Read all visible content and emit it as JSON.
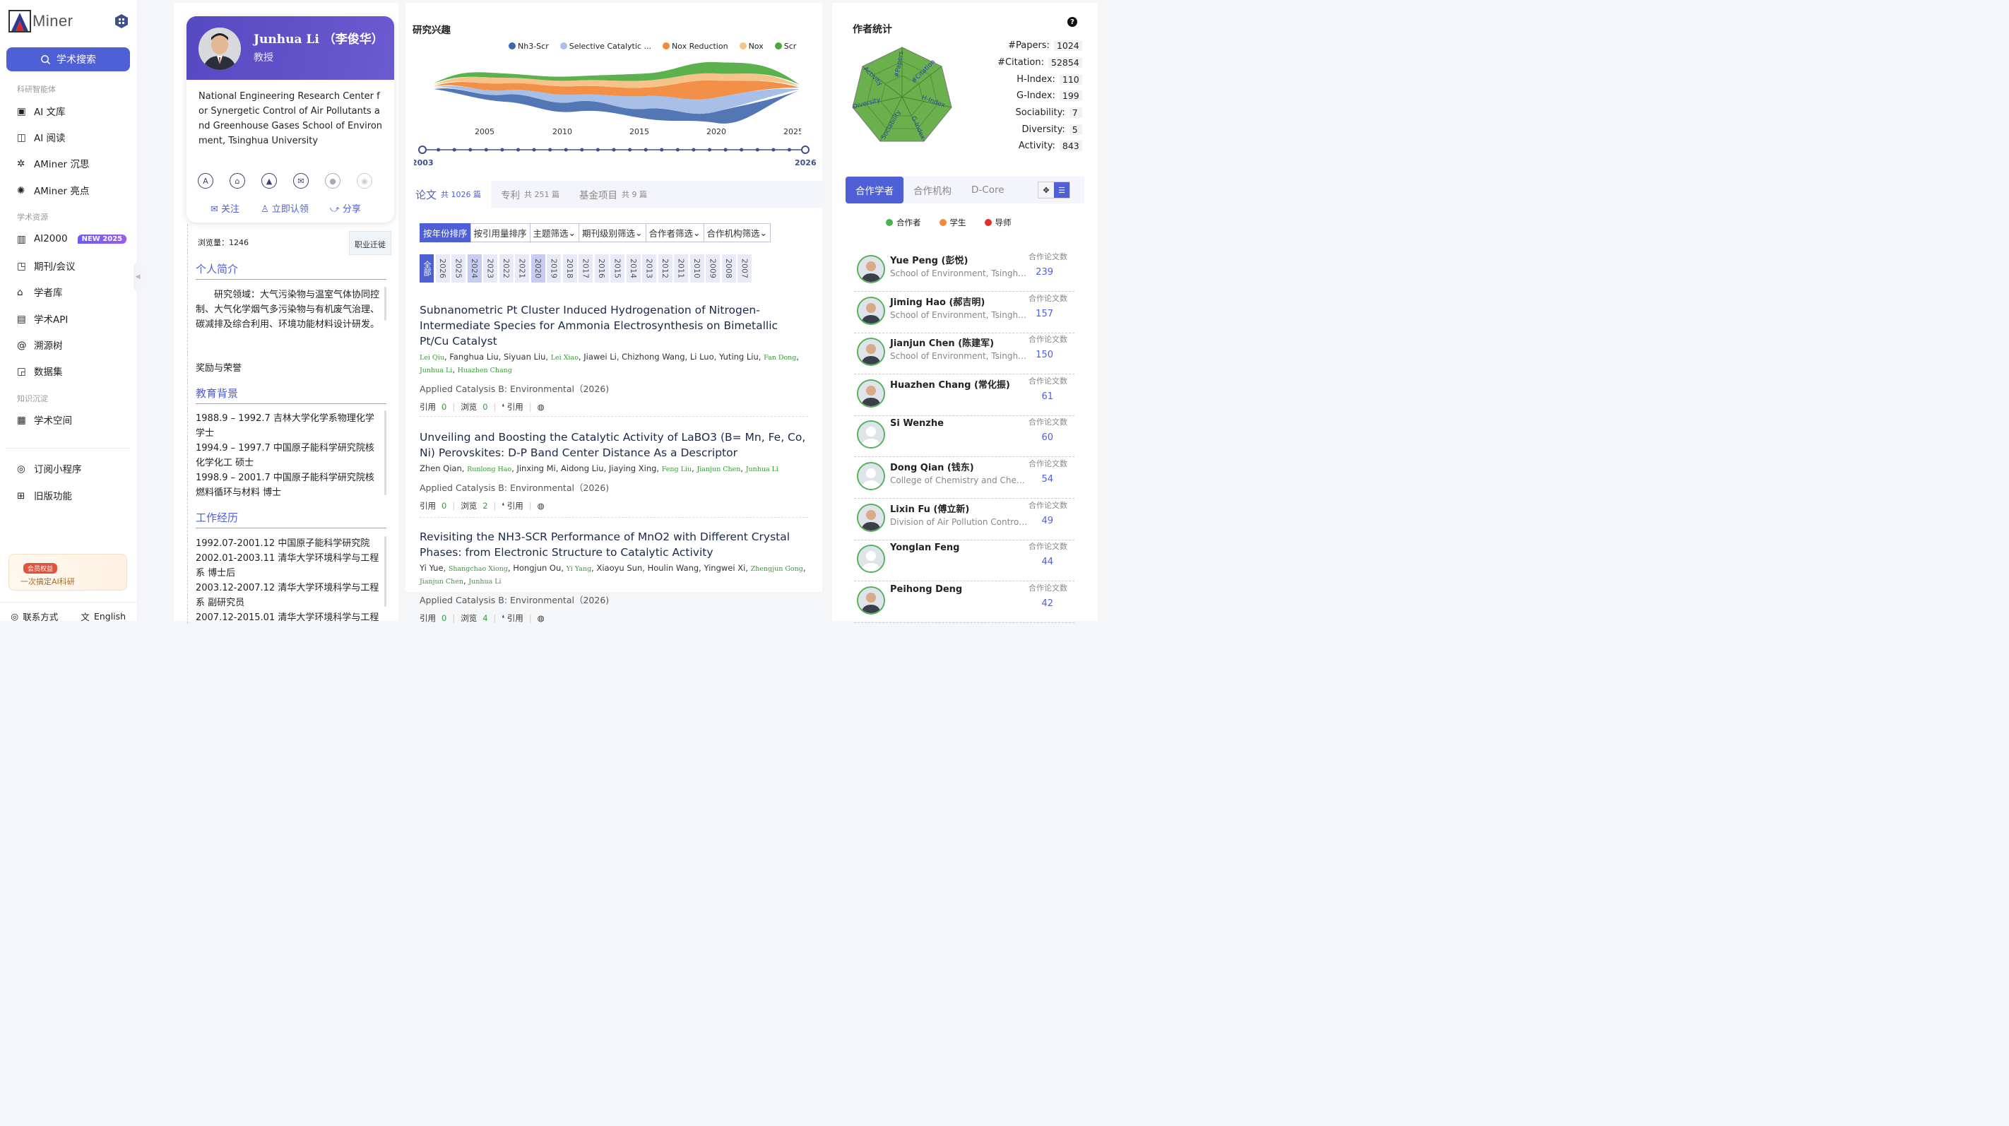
{
  "app": {
    "logo_text": "Miner"
  },
  "sidebar": {
    "search_label": "学术搜索",
    "sections": {
      "ai": "科研智能体",
      "resources": "学术资源",
      "knowledge": "知识沉淀"
    },
    "items": [
      {
        "label": "AI 文库",
        "icon": "book-icon"
      },
      {
        "label": "AI 阅读",
        "icon": "reader-icon"
      },
      {
        "label": "AMiner 沉思",
        "icon": "think-icon"
      },
      {
        "label": "AMiner 亮点",
        "icon": "spark-icon"
      },
      {
        "label": "AI2000",
        "icon": "chart-icon",
        "badge": "NEW 2025"
      },
      {
        "label": "期刊/会议",
        "icon": "journal-icon"
      },
      {
        "label": "学者库",
        "icon": "scholar-icon"
      },
      {
        "label": "学术API",
        "icon": "api-icon"
      },
      {
        "label": "溯源树",
        "icon": "tree-icon"
      },
      {
        "label": "数据集",
        "icon": "dataset-icon"
      },
      {
        "label": "学术空间",
        "icon": "space-icon"
      },
      {
        "label": "订阅小程序",
        "icon": "subscribe-icon"
      },
      {
        "label": "旧版功能",
        "icon": "legacy-icon"
      }
    ],
    "promo": {
      "tag": "会员权益",
      "text": "一次搞定AI科研"
    },
    "bottom": {
      "contact": "联系方式",
      "language": "English"
    }
  },
  "profile": {
    "name": "Junhua Li （李俊华）",
    "title": "教授",
    "affiliation": "National Engineering Research Center for Synergetic Control of Air Pollutants and Greenhouse Gases School of Environment, Tsinghua University",
    "actions": {
      "follow": "关注",
      "claim": "立即认领",
      "share": "分享"
    },
    "views": "浏览量：1246",
    "career": "职业迁徙",
    "sections": {
      "intro": {
        "heading": "个人简介",
        "text": "研究领域：大气污染物与温室气体协同控制、大气化学烟气多污染物与有机废气治理、碳减排及综合利用、环境功能材料设计研发。",
        "awards": "奖励与荣誉"
      },
      "education": {
        "heading": "教育背景",
        "lines": [
          "1988.9 – 1992.7 吉林大学化学系物理化学学士",
          "1994.9 – 1997.7 中国原子能科学研究院核化学化工 硕士",
          "1998.9 – 2001.7 中国原子能科学研究院核燃料循环与材料 博士"
        ]
      },
      "work": {
        "heading": "工作经历",
        "lines": [
          "1992.07-2001.12 中国原子能科学研究院",
          "2002.01-2003.11 清华大学环境科学与工程系 博士后",
          "2003.12-2007.12 清华大学环境科学与工程系 副研究员",
          "2007.12-2015.01 清华大学环境科学与工程"
        ]
      }
    }
  },
  "interests": {
    "title": "研究兴趣",
    "legend": [
      {
        "name": "Nh3-Scr",
        "color": "#3f68ac"
      },
      {
        "name": "Selective Catalytic ...",
        "color": "#a8c0e8"
      },
      {
        "name": "Nox Reduction",
        "color": "#f08a3c"
      },
      {
        "name": "Nox",
        "color": "#f6c48a"
      },
      {
        "name": "Scr",
        "color": "#4aa83c"
      }
    ],
    "axis_years": [
      "2005",
      "2010",
      "2015",
      "2020",
      "2025"
    ],
    "timeline_start": "2003",
    "timeline_end": "2026"
  },
  "tabs": [
    {
      "label": "论文",
      "count": "共 1026 篇"
    },
    {
      "label": "专利",
      "count": "共 251 篇"
    },
    {
      "label": "基金项目",
      "count": "共 9 篇"
    }
  ],
  "filters": [
    "按年份排序",
    "按引用量排序",
    "主题筛选",
    "期刊级别筛选",
    "合作者筛选",
    "合作机构筛选"
  ],
  "years": [
    "全部",
    "2026",
    "2025",
    "2024",
    "2023",
    "2022",
    "2021",
    "2020",
    "2019",
    "2018",
    "2017",
    "2016",
    "2015",
    "2014",
    "2013",
    "2012",
    "2011",
    "2010",
    "2009",
    "2008",
    "2007"
  ],
  "papers": [
    {
      "title": "Subnanometric Pt Cluster Induced Hydrogenation of Nitrogen-Intermediate Species for Ammonia Electrosynthesis on Bimetallic Pt/Cu Catalyst",
      "authors": [
        [
          "Lei Qiu",
          true
        ],
        [
          "Fanghua Liu",
          false
        ],
        [
          "Siyuan Liu",
          false
        ],
        [
          "Lei Xiao",
          true
        ],
        [
          "Jiawei Li",
          false
        ],
        [
          "Chizhong Wang",
          false
        ],
        [
          "Li Luo",
          false
        ],
        [
          "Yuting Liu",
          false
        ],
        [
          "Fan Dong",
          true
        ],
        [
          "Junhua Li",
          true
        ],
        [
          "Huazhen Chang",
          true
        ]
      ],
      "venue": "Applied Catalysis B: Environmental（2026)",
      "cite_label": "引用",
      "cite": "0",
      "view_label": "浏览",
      "view": "0",
      "quote": "引用"
    },
    {
      "title": "Unveiling and Boosting the Catalytic Activity of LaBO3 (B= Mn, Fe, Co, Ni) Perovskites: D-P Band Center Distance As a Descriptor",
      "authors": [
        [
          "Zhen Qian",
          false
        ],
        [
          "Runlong Hao",
          true
        ],
        [
          "Jinxing Mi",
          false
        ],
        [
          "Aidong Liu",
          false
        ],
        [
          "Jiaying Xing",
          false
        ],
        [
          "Feng Liu",
          true
        ],
        [
          "Jianjun Chen",
          true
        ],
        [
          "Junhua Li",
          true
        ]
      ],
      "venue": "Applied Catalysis B: Environmental（2026)",
      "cite_label": "引用",
      "cite": "0",
      "view_label": "浏览",
      "view": "2",
      "quote": "引用"
    },
    {
      "title": "Revisiting the NH3-SCR Performance of MnO2 with Different Crystal Phases: from Electronic Structure to Catalytic Activity",
      "authors": [
        [
          "Yi Yue",
          false
        ],
        [
          "Shangchao Xiong",
          true
        ],
        [
          "Hongjun Ou",
          false
        ],
        [
          "Yi Yang",
          true
        ],
        [
          "Xiaoyu Sun",
          false
        ],
        [
          "Houlin Wang",
          false
        ],
        [
          "Yingwei Xi",
          false
        ],
        [
          "Zhengjun Gong",
          true
        ],
        [
          "Jianjun Chen",
          true
        ],
        [
          "Junhua Li",
          true
        ]
      ],
      "venue": "Applied Catalysis B: Environmental（2026)",
      "cite_label": "引用",
      "cite": "0",
      "view_label": "浏览",
      "view": "4",
      "quote": "引用"
    }
  ],
  "author_stats": {
    "title": "作者统计",
    "radar_labels": [
      "#Papers",
      "#Citation",
      "H-Index",
      "G-Index",
      "Sociability",
      "Diversity",
      "Activity"
    ],
    "rows": [
      {
        "k": "#Papers:",
        "v": "1024"
      },
      {
        "k": "#Citation:",
        "v": "52854"
      },
      {
        "k": "H-Index:",
        "v": "110"
      },
      {
        "k": "G-Index:",
        "v": "199"
      },
      {
        "k": "Sociability:",
        "v": "7"
      },
      {
        "k": "Diversity:",
        "v": "5"
      },
      {
        "k": "Activity:",
        "v": "843"
      }
    ]
  },
  "coauthor_tabs": [
    "合作学者",
    "合作机构",
    "D-Core"
  ],
  "coauthor_legend": [
    {
      "label": "合作者",
      "color": "#4caf50"
    },
    {
      "label": "学生",
      "color": "#f08a3c"
    },
    {
      "label": "导师",
      "color": "#e03030"
    }
  ],
  "coauthors": [
    {
      "name": "Yue Peng (彭悦)",
      "org": "School of Environment, Tsinghua University",
      "label": "合作论文数",
      "count": "239"
    },
    {
      "name": "Jiming Hao (郝吉明)",
      "org": "School of Environment, Tsinghua University",
      "label": "合作论文数",
      "count": "157"
    },
    {
      "name": "Jianjun Chen (陈建军)",
      "org": "School of Environment, Tsinghua University",
      "label": "合作论文数",
      "count": "150"
    },
    {
      "name": "Huazhen Chang (常化振)",
      "org": "",
      "label": "合作论文数",
      "count": "61"
    },
    {
      "name": "Si Wenzhe",
      "org": "",
      "label": "合作论文数",
      "count": "60"
    },
    {
      "name": "Dong Qian (钱东)",
      "org": "College of Chemistry and Chemical Engineering",
      "label": "合作论文数",
      "count": "54"
    },
    {
      "name": "Lixin Fu (傅立新)",
      "org": "Division of Air Pollution Control, Tsinghua",
      "label": "合作论文数",
      "count": "49"
    },
    {
      "name": "Yonglan Feng",
      "org": "",
      "label": "合作论文数",
      "count": "44"
    },
    {
      "name": "Peihong Deng",
      "org": "",
      "label": "合作论文数",
      "count": "42"
    }
  ]
}
